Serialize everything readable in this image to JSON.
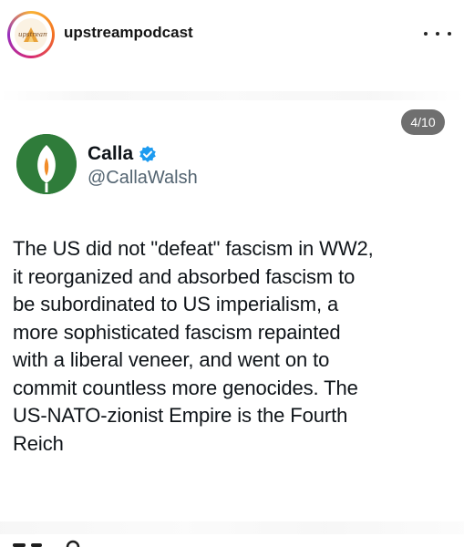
{
  "post": {
    "username": "upstreampodcast",
    "avatar_text": "upstream",
    "more_icon": "more-horizontal-icon",
    "page_indicator": "4/10"
  },
  "tweet": {
    "display_name": "Calla",
    "verified": true,
    "handle": "@CallaWalsh",
    "lines": [
      "The US did not \"defeat\" fascism in WW2,",
      "it reorganized and absorbed fascism to",
      "be subordinated to US imperialism, a",
      "more sophisticated fascism repainted",
      "with a liberal veneer, and went on to",
      "commit countless more genocides. The",
      "US-NATO-zionist Empire is the Fourth",
      "Reich"
    ]
  },
  "colors": {
    "verified_blue": "#1d9bf0",
    "avatar_green": "#2f7c3a",
    "badge_gray": "#6f6f6f"
  }
}
